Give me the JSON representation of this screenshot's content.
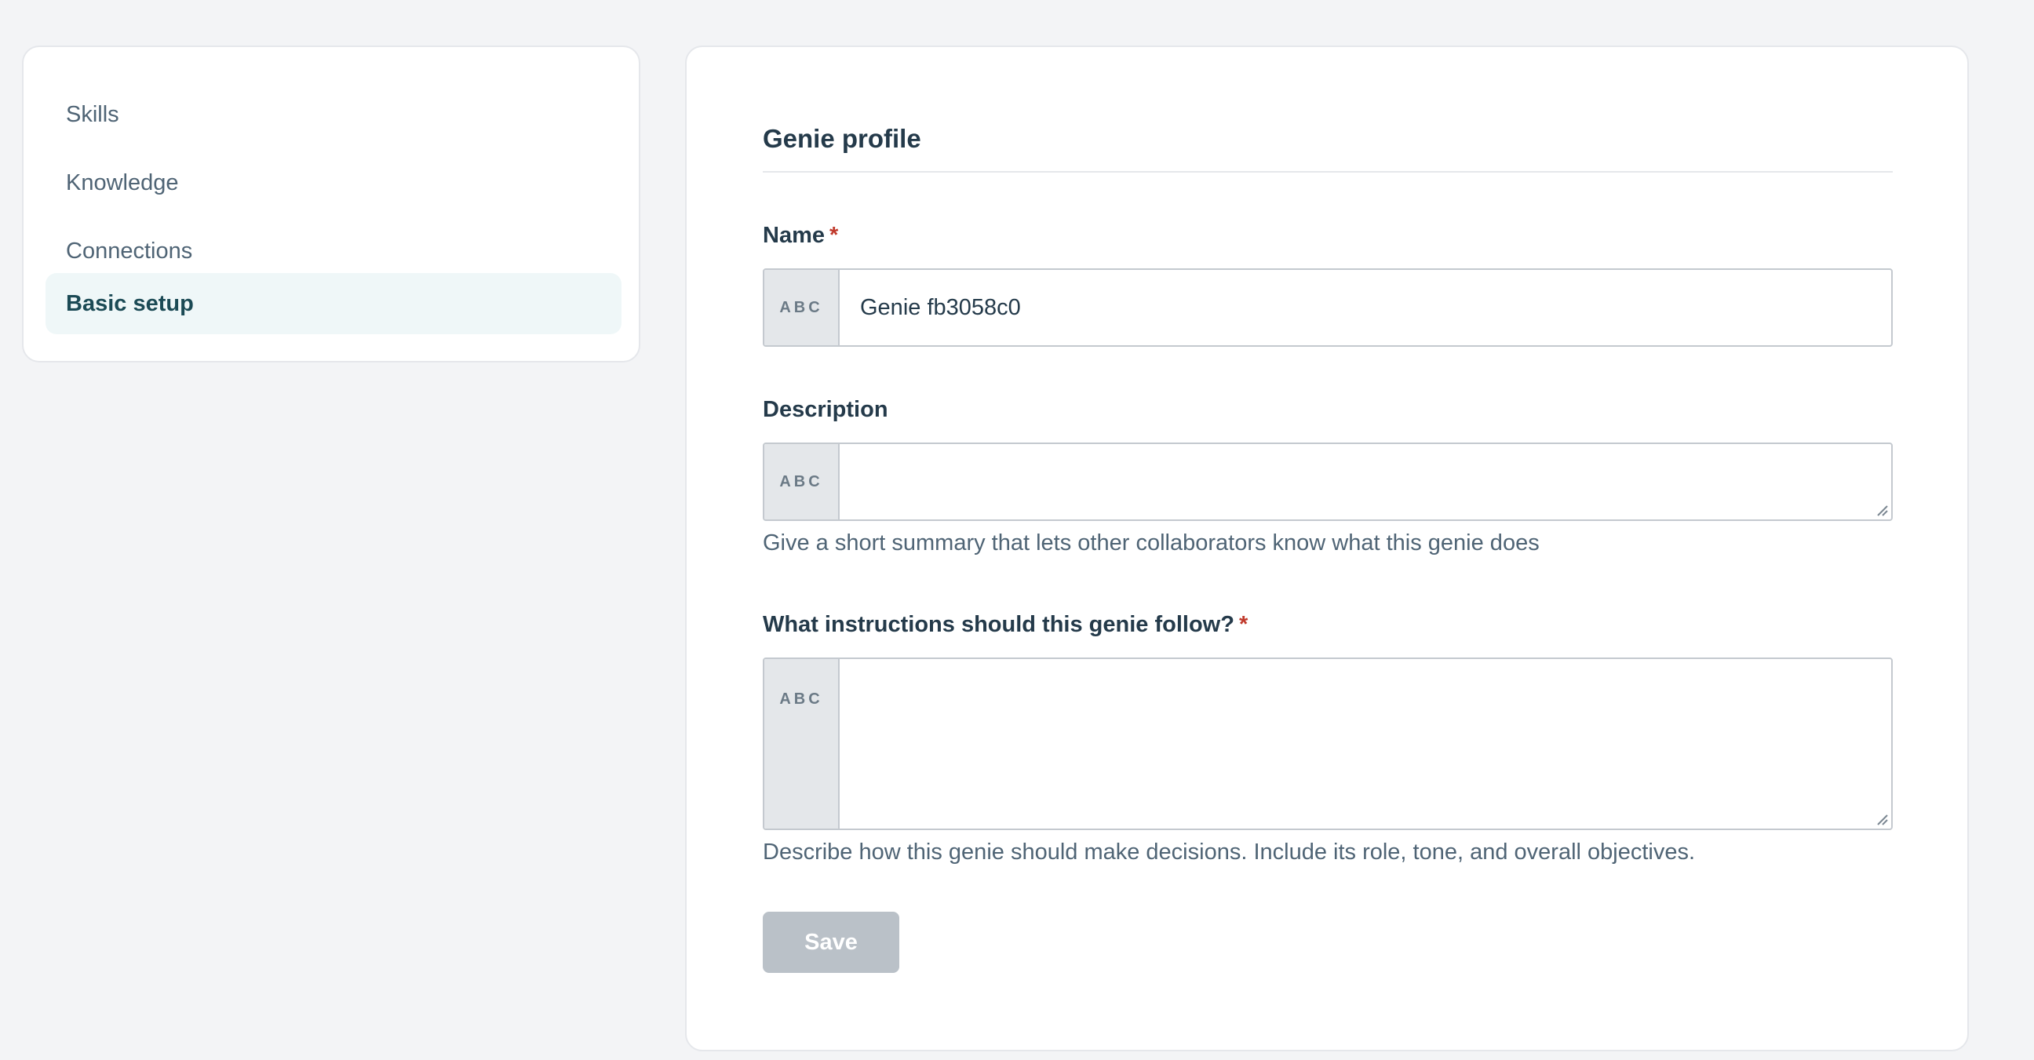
{
  "sidebar": {
    "items": [
      {
        "label": "Skills",
        "active": false
      },
      {
        "label": "Knowledge",
        "active": false
      },
      {
        "label": "Connections",
        "active": false
      },
      {
        "label": "Basic setup",
        "active": true
      }
    ]
  },
  "profile": {
    "title": "Genie profile",
    "name": {
      "label": "Name",
      "required_mark": "*",
      "prefix": "ABC",
      "value": "Genie fb3058c0"
    },
    "description": {
      "label": "Description",
      "prefix": "ABC",
      "value": "",
      "help": "Give a short summary that lets other collaborators know what this genie does"
    },
    "instructions": {
      "label": "What instructions should this genie follow?",
      "required_mark": "*",
      "prefix": "ABC",
      "value": "",
      "help": "Describe how this genie should make decisions. Include its role, tone, and overall objectives."
    },
    "save_label": "Save"
  },
  "colors": {
    "background": "#f3f4f6",
    "active_nav_bg": "#eff7f8",
    "required": "#c0392b",
    "save_disabled": "#bac1c8"
  }
}
